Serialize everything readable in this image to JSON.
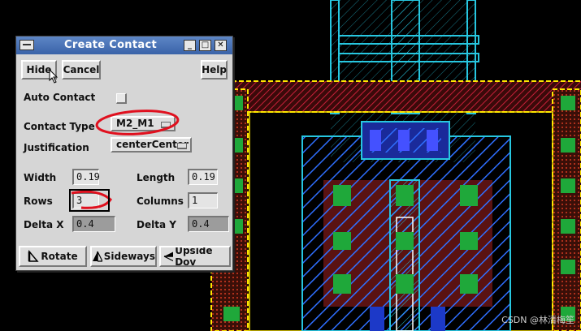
{
  "window": {
    "title": "Create Contact",
    "controls": {
      "minimize": "_",
      "maximize": "□",
      "close": "✕"
    }
  },
  "buttons": {
    "hide": "Hide",
    "cancel": "Cancel",
    "help": "Help",
    "rotate": "Rotate",
    "sideways": "Sideways",
    "upside_down": "Upside Dov"
  },
  "form": {
    "auto_contact_label": "Auto Contact",
    "auto_contact_checked": false,
    "contact_type_label": "Contact Type",
    "contact_type_value": "M2_M1",
    "justification_label": "Justification",
    "justification_value": "centerCenter",
    "width_label": "Width",
    "width_value": "0.19",
    "length_label": "Length",
    "length_value": "0.19",
    "rows_label": "Rows",
    "rows_value": "3",
    "columns_label": "Columns",
    "columns_value": "1",
    "delta_x_label": "Delta X",
    "delta_x_value": "0.4",
    "delta_y_label": "Delta Y",
    "delta_y_value": "0.4"
  },
  "watermark": "CSDN @林清梅笙",
  "colors": {
    "metal1": "#2f6fff",
    "metal2_outline": "#27c7e0",
    "poly": "#d21f2f",
    "contact": "#1fa83a",
    "implant": "#ffe600",
    "annotation": "#e0101e"
  }
}
